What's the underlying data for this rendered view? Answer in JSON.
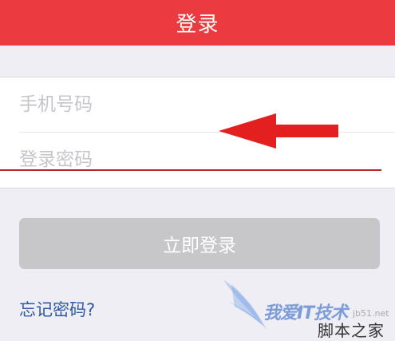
{
  "header": {
    "title": "登录"
  },
  "form": {
    "phone": {
      "placeholder": "手机号码",
      "value": ""
    },
    "password": {
      "placeholder": "登录密码",
      "value": ""
    }
  },
  "login_button": {
    "label": "立即登录"
  },
  "forgot_link": {
    "label": "忘记密码?"
  },
  "watermark": {
    "brand_text": "我爱IT技术",
    "domain": "jb51.net",
    "site_name": "脚本之家"
  },
  "annotation": {
    "arrow_icon": "left-arrow-icon",
    "arrow_color": "#e3201f"
  },
  "colors": {
    "header_bg": "#ec3b40",
    "page_bg": "#efeef4",
    "button_disabled": "#c7c7c9",
    "link": "#2d5aa3",
    "underline": "#b52a24"
  }
}
